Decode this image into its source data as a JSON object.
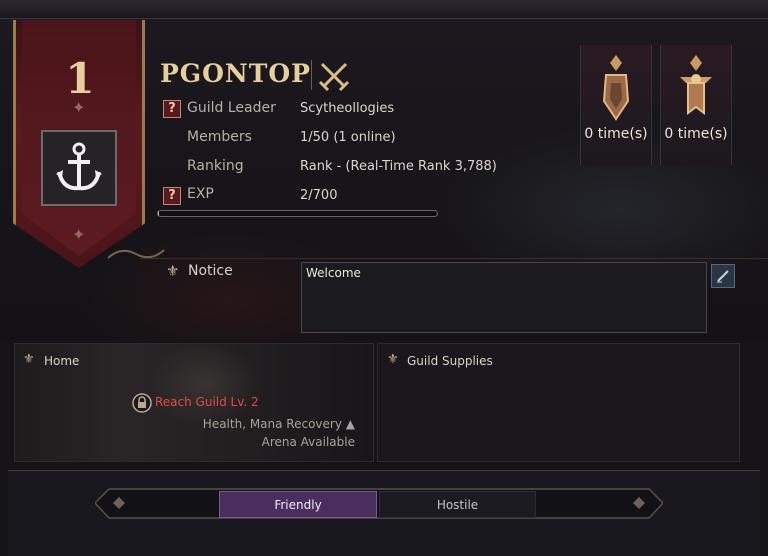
{
  "guild": {
    "rank": "1",
    "name": "PGONTOP"
  },
  "info": {
    "leader_label": "Guild Leader",
    "leader_value": "Scytheollogies",
    "members_label": "Members",
    "members_value": "1/50 (1 online)",
    "ranking_label": "Ranking",
    "ranking_value": "Rank - (Real-Time Rank 3,788)",
    "exp_label": "EXP",
    "exp_value": "2/700",
    "exp_progress": 0.003,
    "help_glyph": "?"
  },
  "trophies": [
    {
      "icon": "crystal-trophy-icon",
      "count": "0 time(s)"
    },
    {
      "icon": "medal-trophy-icon",
      "count": "0 time(s)"
    }
  ],
  "notice": {
    "title": "Notice",
    "text": "Welcome"
  },
  "home": {
    "title": "Home",
    "locked_text": "Reach Guild Lv. 2",
    "perk_1": "Health, Mana Recovery ▲",
    "perk_2": "Arena Available"
  },
  "supplies": {
    "title": "Guild Supplies"
  },
  "tabs": {
    "friendly": "Friendly",
    "hostile": "Hostile"
  },
  "colors": {
    "gold": "#e6cf9c",
    "banner": "#5a1a1f",
    "locked": "#e04a45",
    "tab_active": "#4a2f5e"
  }
}
